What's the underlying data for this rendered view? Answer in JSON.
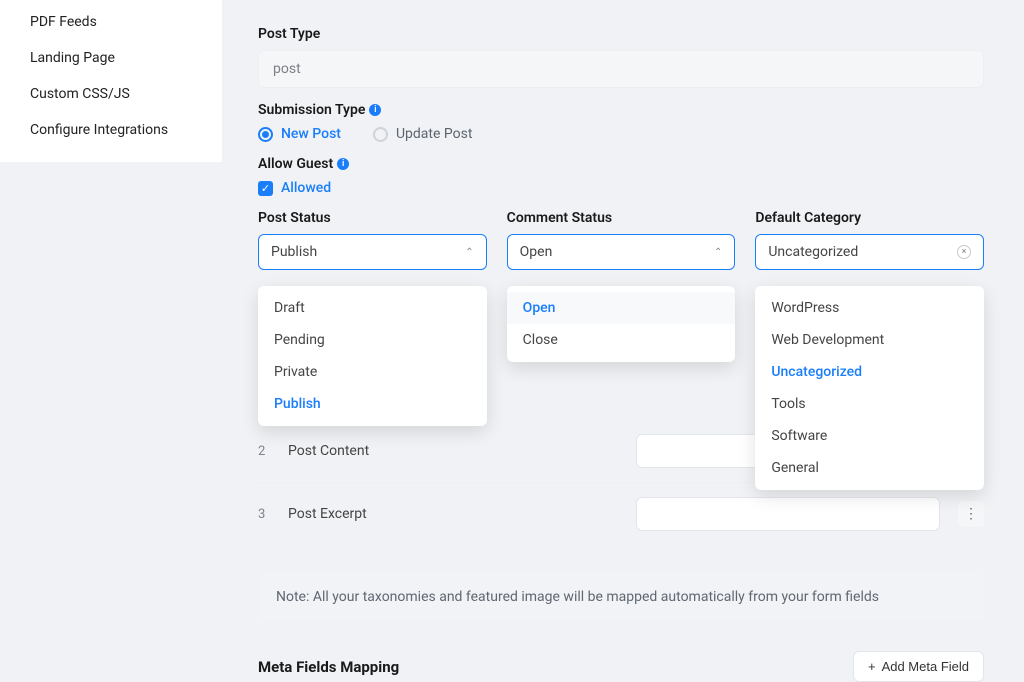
{
  "sidebar": {
    "items": [
      {
        "label": "PDF Feeds"
      },
      {
        "label": "Landing Page"
      },
      {
        "label": "Custom CSS/JS"
      },
      {
        "label": "Configure Integrations"
      }
    ]
  },
  "postType": {
    "label": "Post Type",
    "value": "post"
  },
  "submissionType": {
    "label": "Submission Type",
    "options": [
      {
        "label": "New Post",
        "selected": true
      },
      {
        "label": "Update Post",
        "selected": false
      }
    ]
  },
  "allowGuest": {
    "label": "Allow Guest",
    "checkLabel": "Allowed"
  },
  "postStatus": {
    "label": "Post Status",
    "value": "Publish",
    "options": [
      "Draft",
      "Pending",
      "Private",
      "Publish"
    ]
  },
  "commentStatus": {
    "label": "Comment Status",
    "value": "Open",
    "options": [
      "Open",
      "Close"
    ]
  },
  "defaultCategory": {
    "label": "Default Category",
    "value": "Uncategorized",
    "options": [
      "WordPress",
      "Web Development",
      "Uncategorized",
      "Tools",
      "Software",
      "General"
    ]
  },
  "fields": [
    {
      "num": "2",
      "name": "Post Content"
    },
    {
      "num": "3",
      "name": "Post Excerpt"
    }
  ],
  "note": "Note: All your taxonomies and featured image will be mapped automatically from your form fields",
  "metaMapping": {
    "title": "Meta Fields Mapping",
    "addBtn": "Add Meta Field"
  }
}
